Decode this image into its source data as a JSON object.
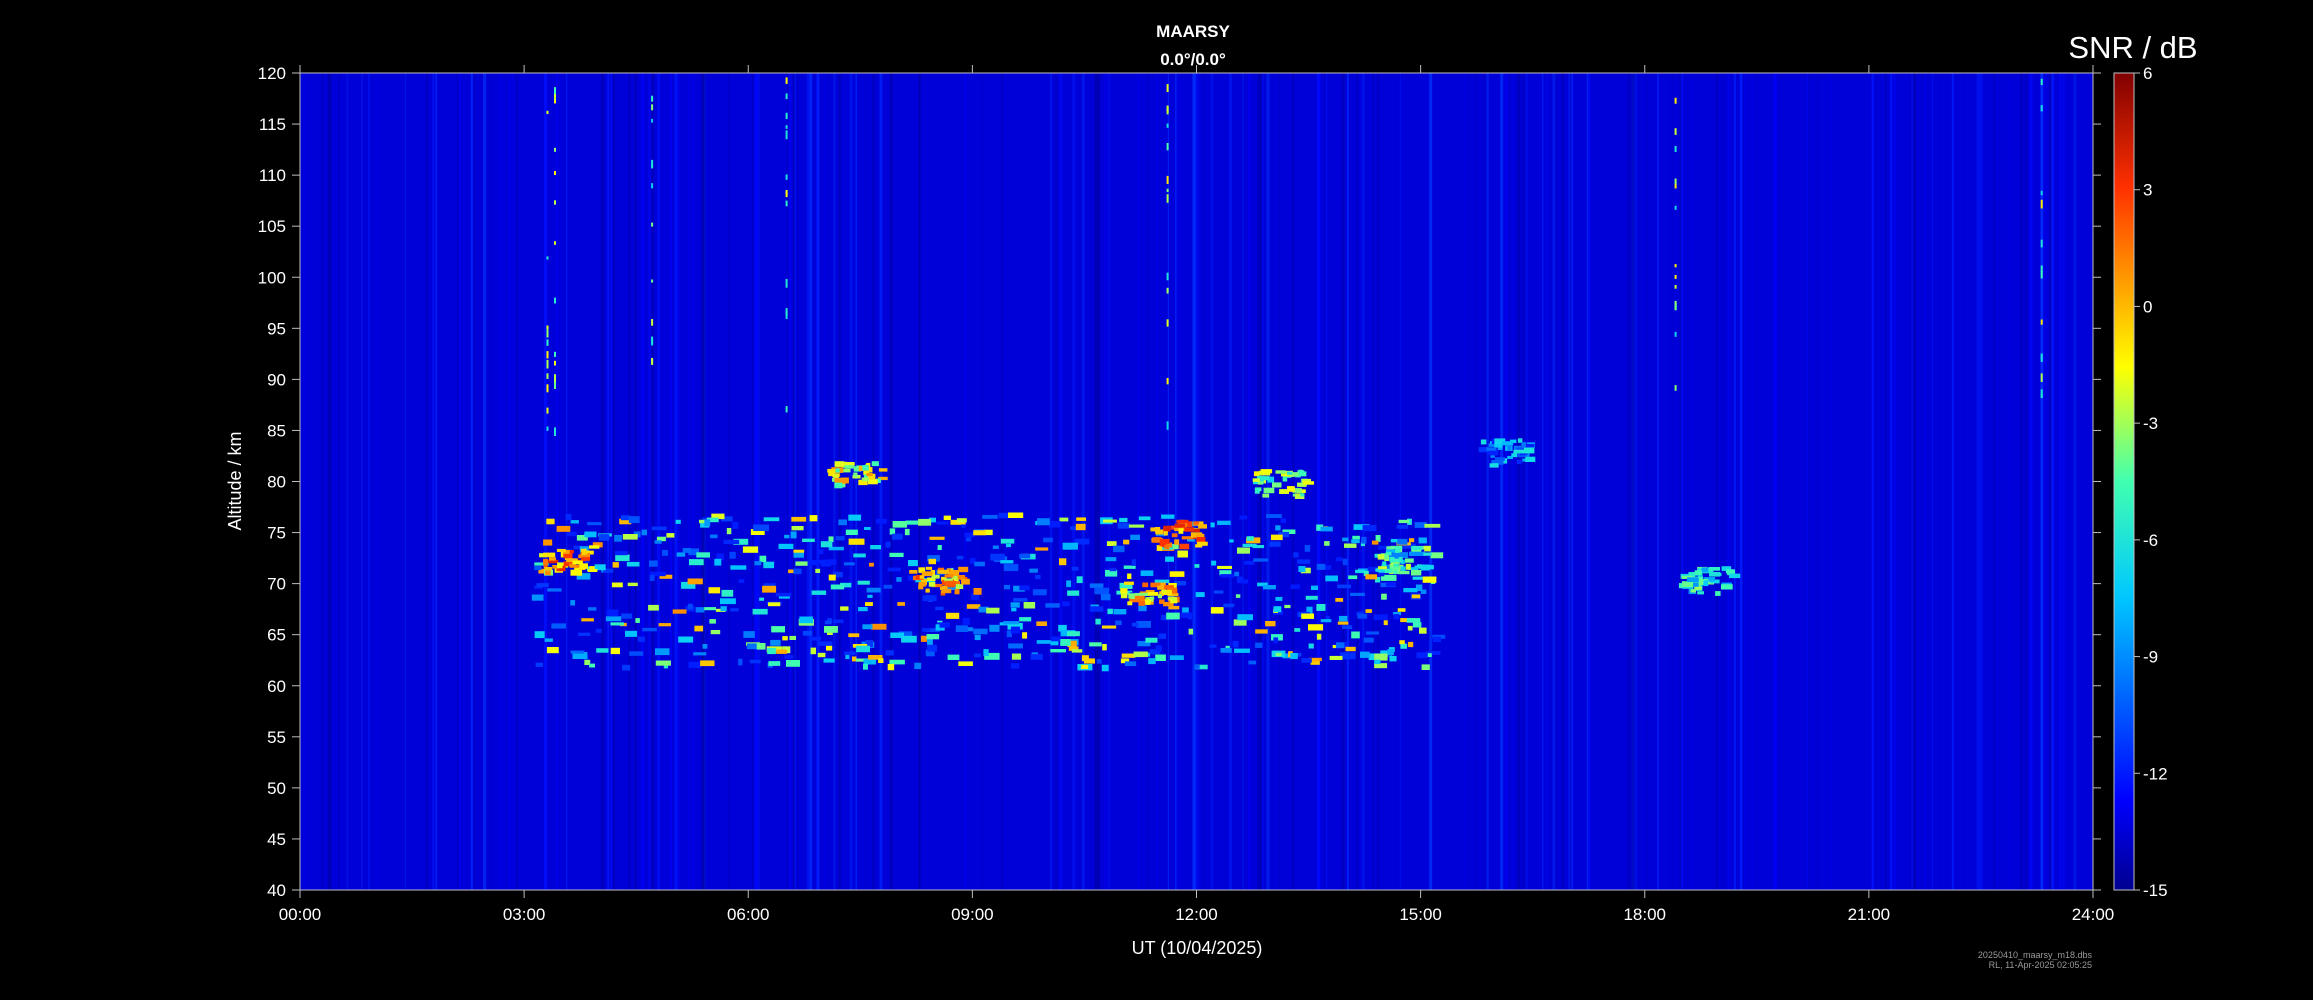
{
  "chart_data": {
    "type": "heatmap",
    "title": "MAARSY",
    "subtitle": "0.0°/0.0°",
    "xlabel": "UT (10/04/2025)",
    "ylabel": "Altitude / km",
    "x_ticks": [
      "00:00",
      "03:00",
      "06:00",
      "09:00",
      "12:00",
      "15:00",
      "18:00",
      "21:00",
      "24:00"
    ],
    "xlim_hours": [
      0,
      24
    ],
    "y_ticks": [
      40,
      45,
      50,
      55,
      60,
      65,
      70,
      75,
      80,
      85,
      90,
      95,
      100,
      105,
      110,
      115,
      120
    ],
    "ylim": [
      40,
      120
    ],
    "colorbar": {
      "label": "SNR / dB",
      "range": [
        -15,
        6
      ],
      "ticks": [
        6,
        3,
        0,
        -3,
        -6,
        -9,
        -12,
        -15
      ],
      "colormap": "jet"
    },
    "background_snr_db": -13.5,
    "features": [
      {
        "label": "main echo layer",
        "t_start_h": 3.1,
        "t_end_h": 15.2,
        "alt_min_km": 62,
        "alt_max_km": 77,
        "snr_max_db": 5
      },
      {
        "label": "strong patch",
        "t_center_h": 3.6,
        "alt_center_km": 72.5,
        "snr_db": 4
      },
      {
        "label": "strong patch",
        "t_center_h": 8.5,
        "alt_center_km": 70.5,
        "snr_db": 3
      },
      {
        "label": "strong patch",
        "t_center_h": 11.7,
        "alt_center_km": 75,
        "snr_db": 4
      },
      {
        "label": "strong patch",
        "t_center_h": 11.3,
        "alt_center_km": 69,
        "snr_db": 2
      },
      {
        "label": "isolated echo",
        "t_center_h": 7.4,
        "alt_center_km": 81,
        "snr_db": 1
      },
      {
        "label": "isolated echo",
        "t_center_h": 13.1,
        "alt_center_km": 80,
        "snr_db": -1
      },
      {
        "label": "isolated echo",
        "t_center_h": 14.7,
        "alt_center_km": 72.5,
        "snr_db": -2
      },
      {
        "label": "weak echo",
        "t_center_h": 18.8,
        "alt_center_km": 70.5,
        "snr_db": -3
      },
      {
        "label": "weak echo",
        "t_center_h": 16.1,
        "alt_center_km": 83,
        "snr_db": -6
      },
      {
        "label": "meteor streaks",
        "times_h": [
          3.3,
          3.4,
          4.7,
          6.5,
          11.6,
          18.4,
          23.3
        ],
        "alt_range_km": [
          85,
          120
        ]
      }
    ]
  },
  "footer": {
    "line1": "20250410_maarsy_m18.dbs",
    "line2": "RL, 11-Apr-2025 02:05:25"
  }
}
